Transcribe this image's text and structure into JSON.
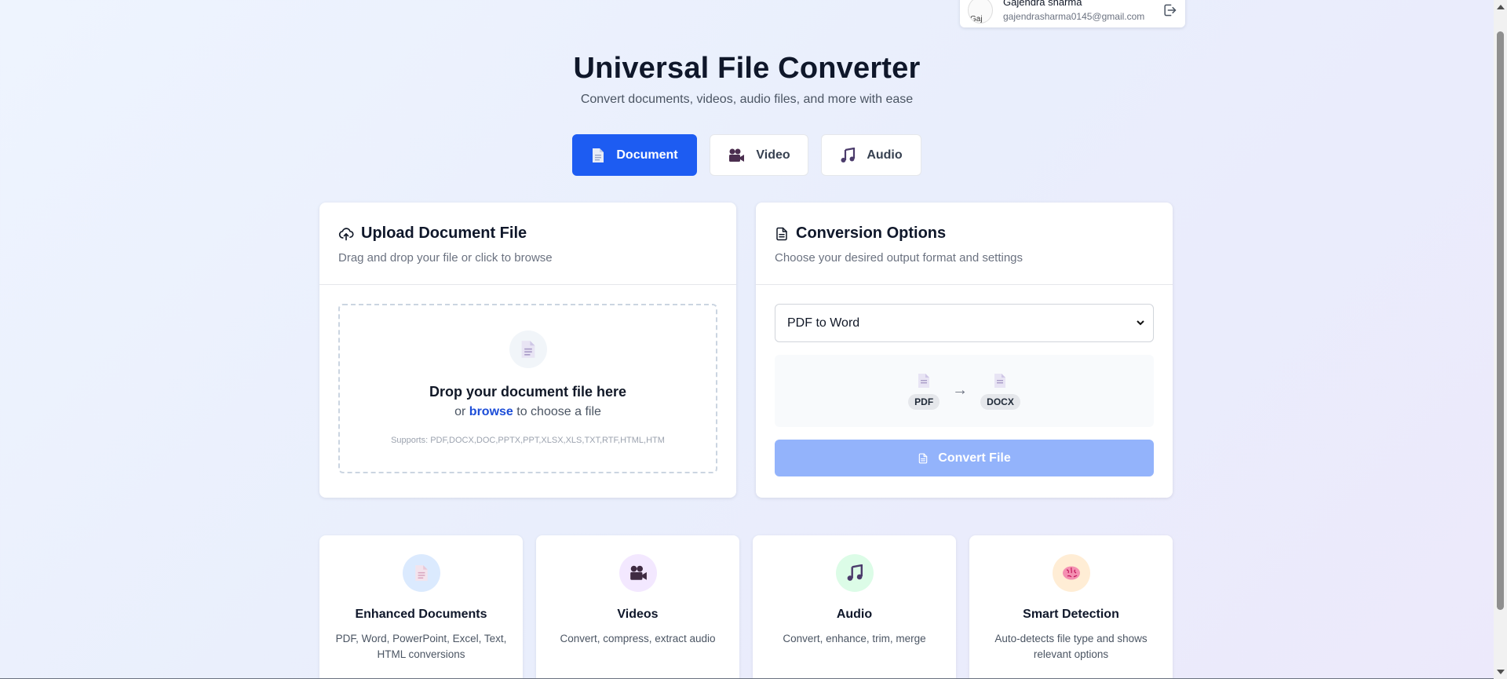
{
  "user": {
    "name": "Gajendra sharma",
    "email": "gajendrasharma0145@gmail.com",
    "avatar_alt": "Gaj"
  },
  "header": {
    "title": "Universal File Converter",
    "subtitle": "Convert documents, videos, audio files, and more with ease"
  },
  "tabs": [
    {
      "label": "Document",
      "icon": "document-icon",
      "active": true
    },
    {
      "label": "Video",
      "icon": "video-camera-icon",
      "active": false
    },
    {
      "label": "Audio",
      "icon": "music-note-icon",
      "active": false
    }
  ],
  "upload": {
    "title": "Upload Document File",
    "description": "Drag and drop your file or click to browse",
    "drop_title": "Drop your document file here",
    "drop_prefix": "or",
    "browse_label": "browse",
    "drop_suffix": "to choose a file",
    "supports": "Supports: PDF,DOCX,DOC,PPTX,PPT,XLSX,XLS,TXT,RTF,HTML,HTM"
  },
  "conversion": {
    "title": "Conversion Options",
    "description": "Choose your desired output format and settings",
    "selected_option": "PDF to Word",
    "from_format": "PDF",
    "arrow": "→",
    "to_format": "DOCX",
    "convert_label": "Convert File"
  },
  "features": [
    {
      "title": "Enhanced Documents",
      "description": "PDF, Word, PowerPoint, Excel, Text, HTML conversions",
      "icon": "document-icon",
      "color": "#dbeafe"
    },
    {
      "title": "Videos",
      "description": "Convert, compress, extract audio",
      "icon": "video-camera-icon",
      "color": "#f3e8ff"
    },
    {
      "title": "Audio",
      "description": "Convert, enhance, trim, merge",
      "icon": "music-note-icon",
      "color": "#dcfce7"
    },
    {
      "title": "Smart Detection",
      "description": "Auto-detects file type and shows relevant options",
      "icon": "brain-icon",
      "color": "#ffedd5"
    }
  ],
  "colors": {
    "accent": "#1d5cf2",
    "accent_disabled": "#93b3fb",
    "text": "#0f172a",
    "muted": "#6b7280"
  }
}
